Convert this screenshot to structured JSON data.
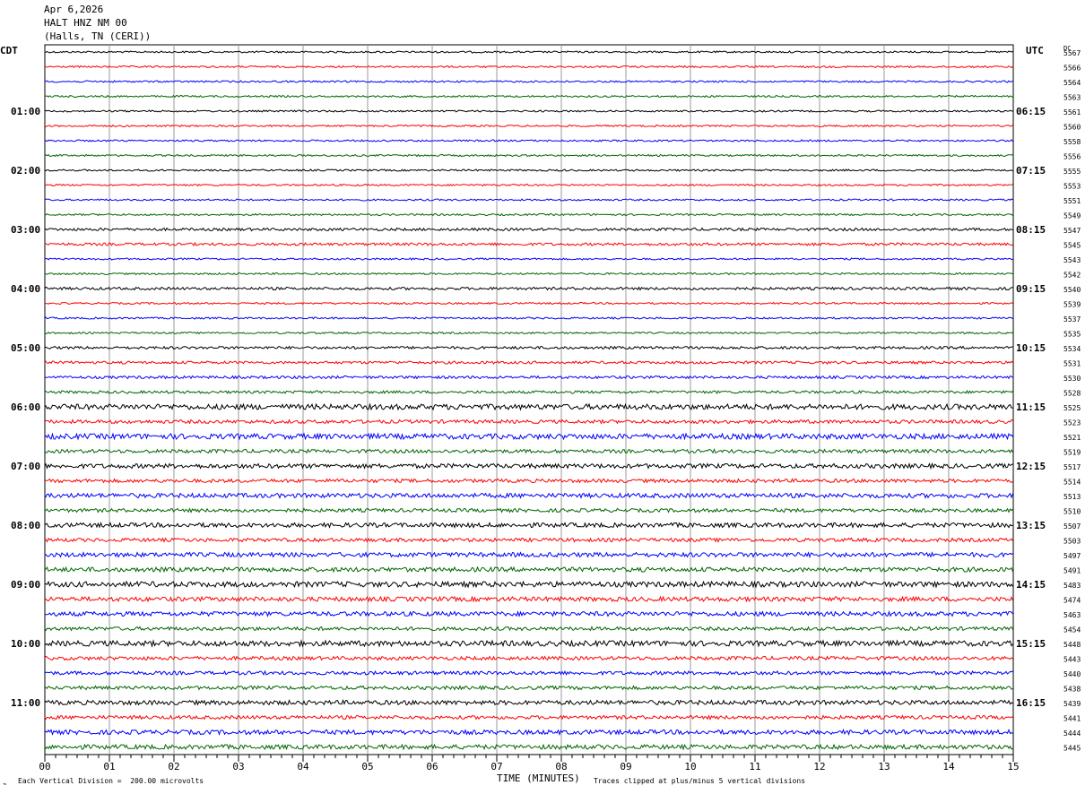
{
  "header": {
    "date": "Apr 6,2026",
    "station": "HALT HNZ NM 00",
    "location": "(Halls, TN (CERI))"
  },
  "left_tz": "CDT",
  "right_tz": "UTC",
  "dc_label": "DC",
  "footer": {
    "scale": "Each Vertical Division =  200.00 microvolts",
    "xtitle": "TIME (MINUTES)",
    "clip_note": "Traces clipped at plus/minus 5 vertical divisions"
  },
  "colors": {
    "trace_cycle": [
      "#000000",
      "#ff0000",
      "#0000ff",
      "#006600"
    ],
    "grid": "#9a9a9a"
  },
  "chart_data": {
    "type": "line",
    "title": "",
    "xlabel": "TIME (MINUTES)",
    "ylabel": "",
    "xlim": [
      0,
      15
    ],
    "x_ticks": [
      "00",
      "01",
      "02",
      "03",
      "04",
      "05",
      "06",
      "07",
      "08",
      "09",
      "10",
      "11",
      "12",
      "13",
      "14",
      "15"
    ],
    "row_count": 48,
    "left_time_labels": [
      {
        "row": 4,
        "text": "01:00"
      },
      {
        "row": 8,
        "text": "02:00"
      },
      {
        "row": 12,
        "text": "03:00"
      },
      {
        "row": 16,
        "text": "04:00"
      },
      {
        "row": 20,
        "text": "05:00"
      },
      {
        "row": 24,
        "text": "06:00"
      },
      {
        "row": 28,
        "text": "07:00"
      },
      {
        "row": 32,
        "text": "08:00"
      },
      {
        "row": 36,
        "text": "09:00"
      },
      {
        "row": 40,
        "text": "10:00"
      },
      {
        "row": 44,
        "text": "11:00"
      }
    ],
    "right_time_labels": [
      {
        "row": 4,
        "text": "06:15"
      },
      {
        "row": 8,
        "text": "07:15"
      },
      {
        "row": 12,
        "text": "08:15"
      },
      {
        "row": 16,
        "text": "09:15"
      },
      {
        "row": 20,
        "text": "10:15"
      },
      {
        "row": 24,
        "text": "11:15"
      },
      {
        "row": 28,
        "text": "12:15"
      },
      {
        "row": 32,
        "text": "13:15"
      },
      {
        "row": 36,
        "text": "14:15"
      },
      {
        "row": 40,
        "text": "15:15"
      },
      {
        "row": 44,
        "text": "16:15"
      }
    ],
    "dc_values": [
      "5567",
      "5566",
      "5564",
      "5563",
      "5561",
      "5560",
      "5558",
      "5556",
      "5555",
      "5553",
      "5551",
      "5549",
      "5547",
      "5545",
      "5543",
      "5542",
      "5540",
      "5539",
      "5537",
      "5535",
      "5534",
      "5531",
      "5530",
      "5528",
      "5525",
      "5523",
      "5521",
      "5519",
      "5517",
      "5514",
      "5513",
      "5510",
      "5507",
      "5503",
      "5497",
      "5491",
      "5483",
      "5474",
      "5463",
      "5454",
      "5448",
      "5443",
      "5440",
      "5438",
      "5439",
      "5441",
      "5444",
      "5445"
    ],
    "noise_level": [
      1,
      1,
      1,
      1,
      1,
      1,
      1,
      1,
      1,
      1,
      1,
      1,
      1.5,
      1.5,
      1,
      1,
      1.5,
      1,
      1,
      1,
      1.5,
      1.5,
      1.5,
      1.5,
      3,
      2,
      3,
      2,
      2.5,
      2,
      2.5,
      2,
      2.5,
      2,
      2.5,
      2.5,
      3,
      2.5,
      2.5,
      2,
      3,
      2,
      2,
      2,
      2.5,
      2,
      2.5,
      2.5
    ]
  }
}
